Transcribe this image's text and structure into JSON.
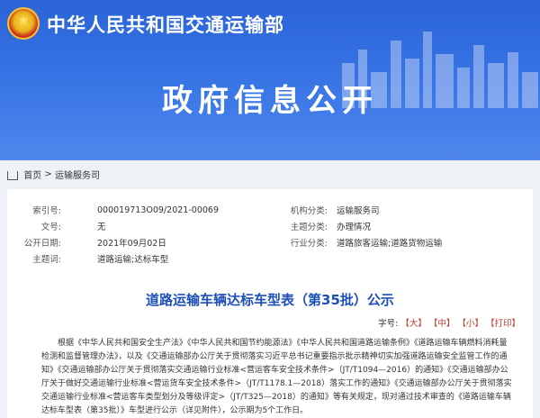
{
  "header": {
    "ministry_name": "中华人民共和国交通运输部",
    "section_title": "政府信息公开"
  },
  "breadcrumb": {
    "home": "首页",
    "sep": ">",
    "current": "运输服务司"
  },
  "meta": {
    "index_label": "索引号:",
    "index_value": "000019713O09/2021-00069",
    "org_label": "机构分类:",
    "org_value": "运输服务司",
    "docno_label": "文号:",
    "docno_value": "无",
    "topic_label": "主题分类:",
    "topic_value": "办理情况",
    "date_label": "公开日期:",
    "date_value": "2021年09月02日",
    "industry_label": "行业分类:",
    "industry_value": "道路旅客运输;道路货物运输",
    "subject_label": "主题词:",
    "subject_value": "道路运输;达标车型"
  },
  "article": {
    "title": "道路运输车辆达标车型表（第35批）公示",
    "fontsize_label": "字号:",
    "fontsize_large": "【大】",
    "fontsize_medium": "【中】",
    "fontsize_small": "【小】",
    "print": "【打印】",
    "body": "根据《中华人民共和国安全生产法》《中华人民共和国节约能源法》《中华人民共和国道路运输条例》《道路运输车辆燃料消耗量检测和监督管理办法》，以及《交通运输部办公厅关于贯彻落实习近平总书记重要指示批示精神切实加强道路运输安全监管工作的通知》《交通运输部办公厅关于贯彻落实交通运输行业标准<营运客车安全技术条件>（JT/T1094—2016）的通知》《交通运输部办公厅关于做好交通运输行业标准<营运货车安全技术条件>（JT/T1178.1—2018）落实工作的通知》《交通运输部办公厅关于贯彻落实交通运输行业标准<营运客车类型划分及等级评定>（JT/T325—2018）的通知》等有关规定，现对通过技术审查的《道路运输车辆达标车型表（第35批）》车型进行公示（详见附件），公示期为5个工作日。"
  }
}
